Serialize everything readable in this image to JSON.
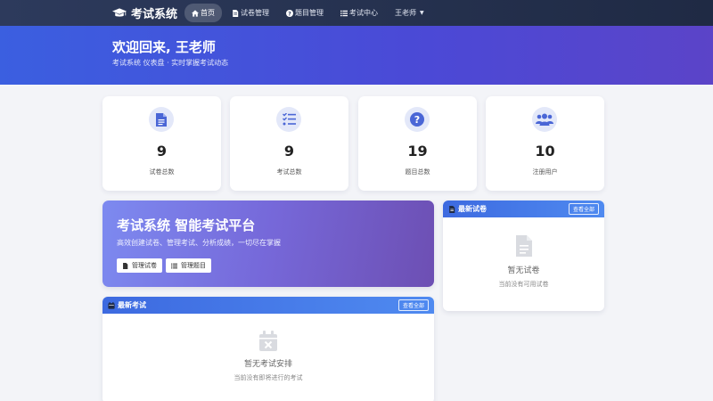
{
  "navbar": {
    "brand": "考试系统",
    "items": [
      {
        "label": "首页",
        "icon": "home-icon",
        "active": true
      },
      {
        "label": "试卷管理",
        "icon": "file-icon"
      },
      {
        "label": "题目管理",
        "icon": "question-icon"
      },
      {
        "label": "考试中心",
        "icon": "list-icon"
      }
    ],
    "user": "王老师"
  },
  "hero": {
    "title": "欢迎回来, 王老师",
    "subtitle": "考试系统 仪表盘 · 实时掌握考试动态"
  },
  "stats": [
    {
      "value": "9",
      "label": "试卷总数",
      "icon": "file-document-icon"
    },
    {
      "value": "9",
      "label": "考试总数",
      "icon": "checklist-icon"
    },
    {
      "value": "19",
      "label": "题目总数",
      "icon": "question-circle-icon"
    },
    {
      "value": "10",
      "label": "注册用户",
      "icon": "users-icon"
    }
  ],
  "promo": {
    "title": "考试系统 智能考试平台",
    "subtitle": "高效创建试卷、管理考试、分析成绩，一切尽在掌握",
    "btn_papers": "管理试卷",
    "btn_questions": "管理题目"
  },
  "recent_exams": {
    "title": "最新考试",
    "view_all": "查看全部",
    "empty_title": "暂无考试安排",
    "empty_sub": "当前没有即将进行的考试"
  },
  "recent_papers": {
    "title": "最新试卷",
    "view_all": "查看全部",
    "empty_title": "暂无试卷",
    "empty_sub": "当前没有可用试卷"
  },
  "colors": {
    "accent": "#3d6ae0",
    "nav_bg": "#2d3a5c",
    "icon": "#4a66d6"
  }
}
